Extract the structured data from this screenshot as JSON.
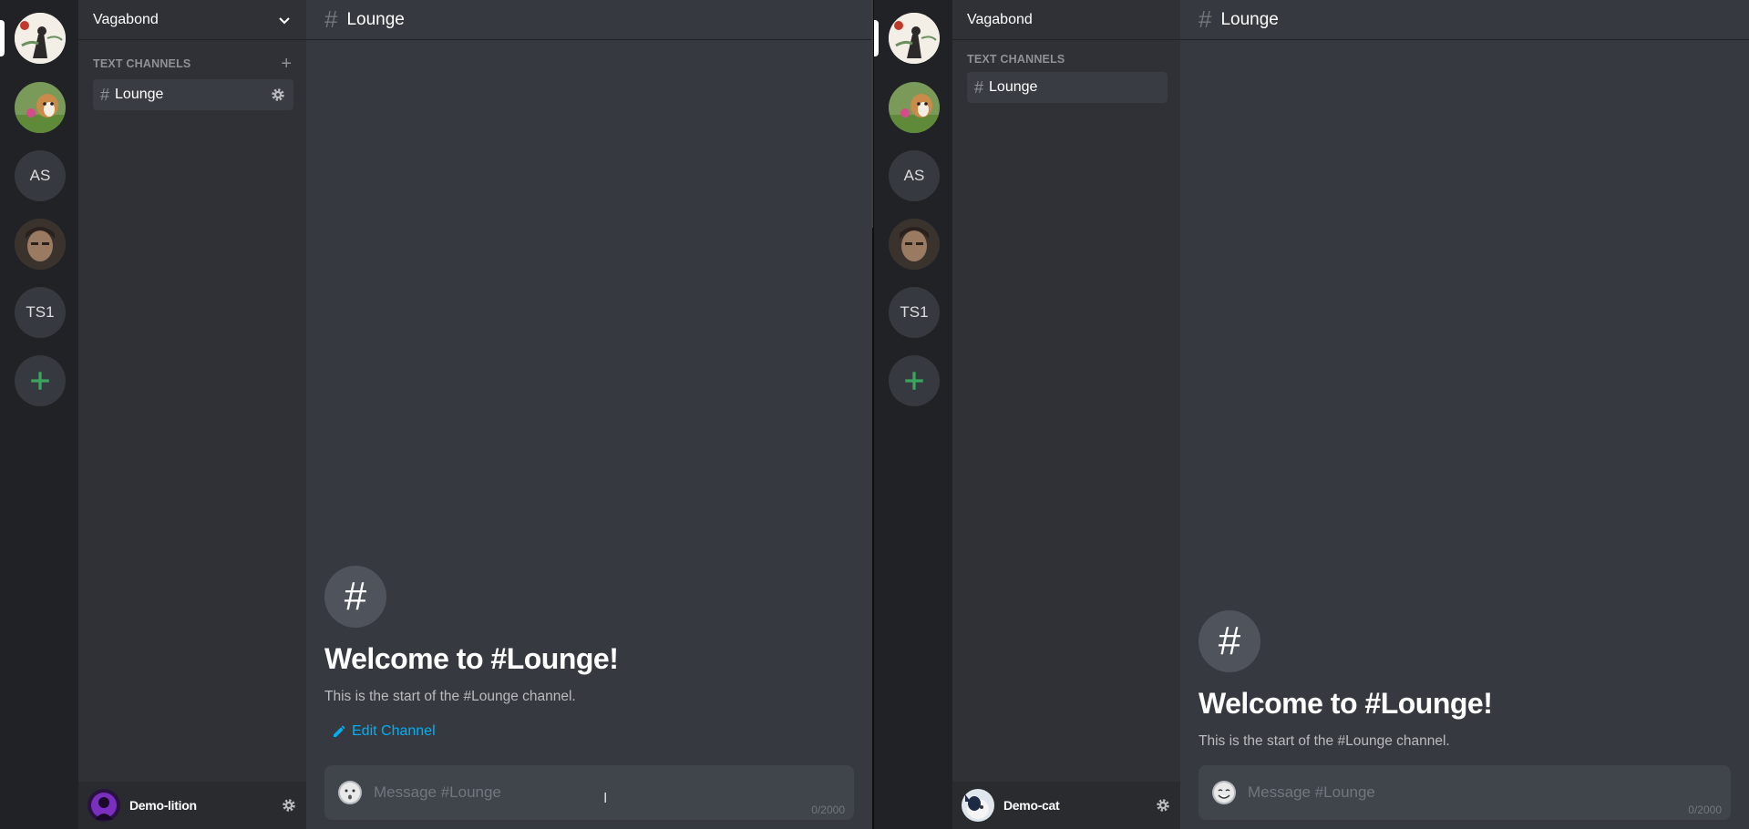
{
  "colors": {
    "rail_bg": "#202225",
    "sidebar_bg": "#2f3136",
    "main_bg": "#36393f",
    "composer_bg": "#40444b",
    "add_server_green": "#3ba55d",
    "link_blue": "#00b0f4"
  },
  "servers": [
    {
      "type": "image",
      "name": "ink-painting-server"
    },
    {
      "type": "image",
      "name": "dog-photo-server"
    },
    {
      "type": "initials",
      "label": "AS"
    },
    {
      "type": "image",
      "name": "portrait-server"
    },
    {
      "type": "initials",
      "label": "TS1"
    },
    {
      "type": "add",
      "icon": "plus-icon"
    }
  ],
  "left": {
    "server_name": "Vagabond",
    "category_label": "TEXT CHANNELS",
    "channel": {
      "hash": "#",
      "name": "Lounge"
    },
    "header": {
      "hash": "#",
      "title": "Lounge"
    },
    "welcome": {
      "hash": "#",
      "title": "Welcome to #Lounge!",
      "subtitle": "This is the start of the #Lounge channel.",
      "edit_label": "Edit Channel"
    },
    "composer": {
      "placeholder": "Message #Lounge",
      "counter": "0/2000"
    },
    "user": {
      "name": "Demo-lition"
    }
  },
  "right": {
    "server_name": "Vagabond",
    "category_label": "TEXT CHANNELS",
    "channel": {
      "hash": "#",
      "name": "Lounge"
    },
    "header": {
      "hash": "#",
      "title": "Lounge"
    },
    "welcome": {
      "hash": "#",
      "title": "Welcome to #Lounge!",
      "subtitle": "This is the start of the #Lounge channel."
    },
    "composer": {
      "placeholder": "Message #Lounge",
      "counter": "0/2000"
    },
    "user": {
      "name": "Demo-cat"
    }
  }
}
